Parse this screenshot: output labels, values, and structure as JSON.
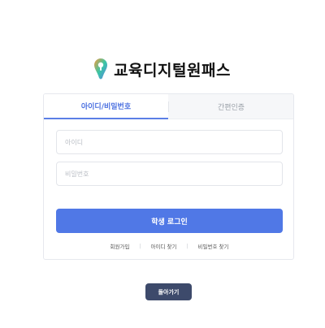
{
  "brand": {
    "name": "교육디지털원패스",
    "logo_icon": "keyhole-pin-icon",
    "colors": {
      "accent": "#5078e6",
      "logo_orange": "#f59a3b",
      "logo_green": "#39c7a5",
      "logo_blue": "#5b7fe6"
    }
  },
  "tabs": [
    {
      "label": "아이디/비밀번호",
      "active": true
    },
    {
      "label": "간편인증",
      "active": false
    }
  ],
  "form": {
    "id_placeholder": "아이디",
    "id_value": "",
    "pw_placeholder": "비밀번호",
    "pw_value": "",
    "login_label": "학생 로그인"
  },
  "links": [
    {
      "label": "회원가입"
    },
    {
      "label": "아이디 찾기"
    },
    {
      "label": "비밀번호 찾기"
    }
  ],
  "back_label": "돌아가기"
}
